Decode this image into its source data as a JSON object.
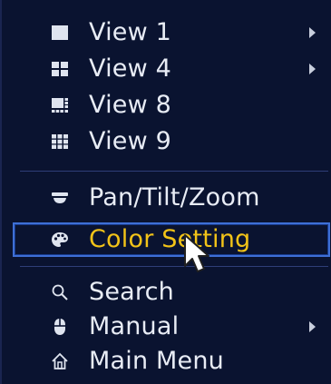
{
  "menu": {
    "items": [
      {
        "label": "View 1",
        "icon": "single-view-icon",
        "has_submenu": true
      },
      {
        "label": "View 4",
        "icon": "quad-view-icon",
        "has_submenu": true
      },
      {
        "label": "View 8",
        "icon": "eight-view-icon",
        "has_submenu": false
      },
      {
        "label": "View 9",
        "icon": "nine-view-icon",
        "has_submenu": false
      },
      {
        "label": "Pan/Tilt/Zoom",
        "icon": "ptz-camera-icon",
        "has_submenu": false
      },
      {
        "label": "Color Setting",
        "icon": "palette-icon",
        "has_submenu": false,
        "selected": true
      },
      {
        "label": "Search",
        "icon": "search-icon",
        "has_submenu": false
      },
      {
        "label": "Manual",
        "icon": "mouse-icon",
        "has_submenu": true
      },
      {
        "label": "Main Menu",
        "icon": "home-icon",
        "has_submenu": false
      }
    ]
  },
  "colors": {
    "background": "#0a1330",
    "text": "#e8ecf5",
    "selected_text": "#f2c318",
    "selected_border": "#3e6fd6",
    "divider": "#2e3e78"
  }
}
